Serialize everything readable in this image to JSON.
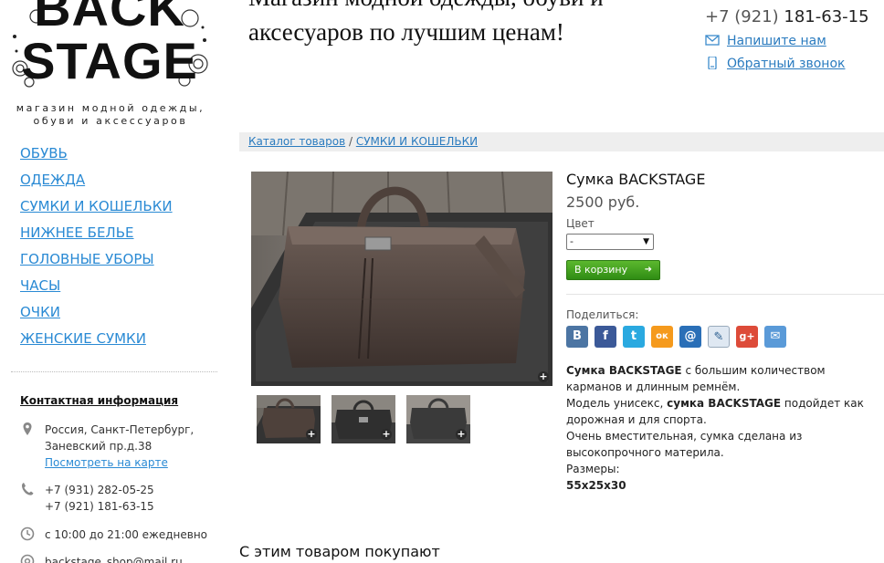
{
  "logo": {
    "line1": "BACK",
    "line2": "STAGE",
    "subtitle": "магазин модной одежды, обуви и аксессуаров"
  },
  "slogan": {
    "line1": "Магазин модной одежды, обуви и",
    "line2": "аксесуаров по лучшим ценам!"
  },
  "header": {
    "phone_prefix": "+7 (921)",
    "phone_number": "181-63-15",
    "write_us": "Напишите нам",
    "callback": "Обратный звонок"
  },
  "nav": [
    "ОБУВЬ",
    "ОДЕЖДА",
    "СУМКИ И КОШЕЛЬКИ",
    "НИЖНЕЕ БЕЛЬЕ",
    "ГОЛОВНЫЕ УБОРЫ",
    "ЧАСЫ",
    "ОЧКИ",
    "ЖЕНСКИЕ СУМКИ"
  ],
  "contacts": {
    "title": "Контактная информация",
    "address_line1": "Россия, Санкт-Петербург,",
    "address_line2": "Заневский пр.д.38",
    "map_link": "Посмотреть на карте",
    "phone1": "+7 (931) 282-05-25",
    "phone2": "+7 (921) 181-63-15",
    "hours": "с 10:00 до 21:00 ежедневно",
    "email": "backstage_shop@mail.ru"
  },
  "breadcrumb": {
    "root": "Каталог товаров",
    "separator": " / ",
    "current": "СУМКИ И КОШЕЛЬКИ"
  },
  "product": {
    "title": "Сумка BACKSTAGE",
    "price": "2500 руб.",
    "color_label": "Цвет",
    "color_value": "-",
    "cart_button": "В корзину",
    "share_label": "Поделиться:",
    "desc_bold1": "Сумка BACKSTAGE",
    "desc_text1": " с большим количеством карманов и длинным ремнём.",
    "desc_text2": "Модель унисекс, ",
    "desc_bold2": "сумка BACKSTAGE",
    "desc_text3": " подойдет как дорожная и для спорта.",
    "desc_text4": "Очень вместительная, сумка сделана из высокопрочного материла.",
    "sizes_label": "Размеры:",
    "sizes_value": "55x25x30"
  },
  "share_icons": [
    {
      "name": "vk-icon",
      "glyph": "В",
      "color": "#4c75a3"
    },
    {
      "name": "facebook-icon",
      "glyph": "f",
      "color": "#3b5998"
    },
    {
      "name": "twitter-icon",
      "glyph": "t",
      "color": "#2aa9e0"
    },
    {
      "name": "odnoklassniki-icon",
      "glyph": "ок",
      "color": "#f59a1d"
    },
    {
      "name": "mailru-icon",
      "glyph": "@",
      "color": "#2a6fb7"
    },
    {
      "name": "livejournal-icon",
      "glyph": "✎",
      "color": "#dfe8f2"
    },
    {
      "name": "googleplus-icon",
      "glyph": "g+",
      "color": "#dd4b39"
    },
    {
      "name": "email-share-icon",
      "glyph": "✉",
      "color": "#5a9ad8"
    }
  ],
  "related_title": "С этим товаром покупают"
}
